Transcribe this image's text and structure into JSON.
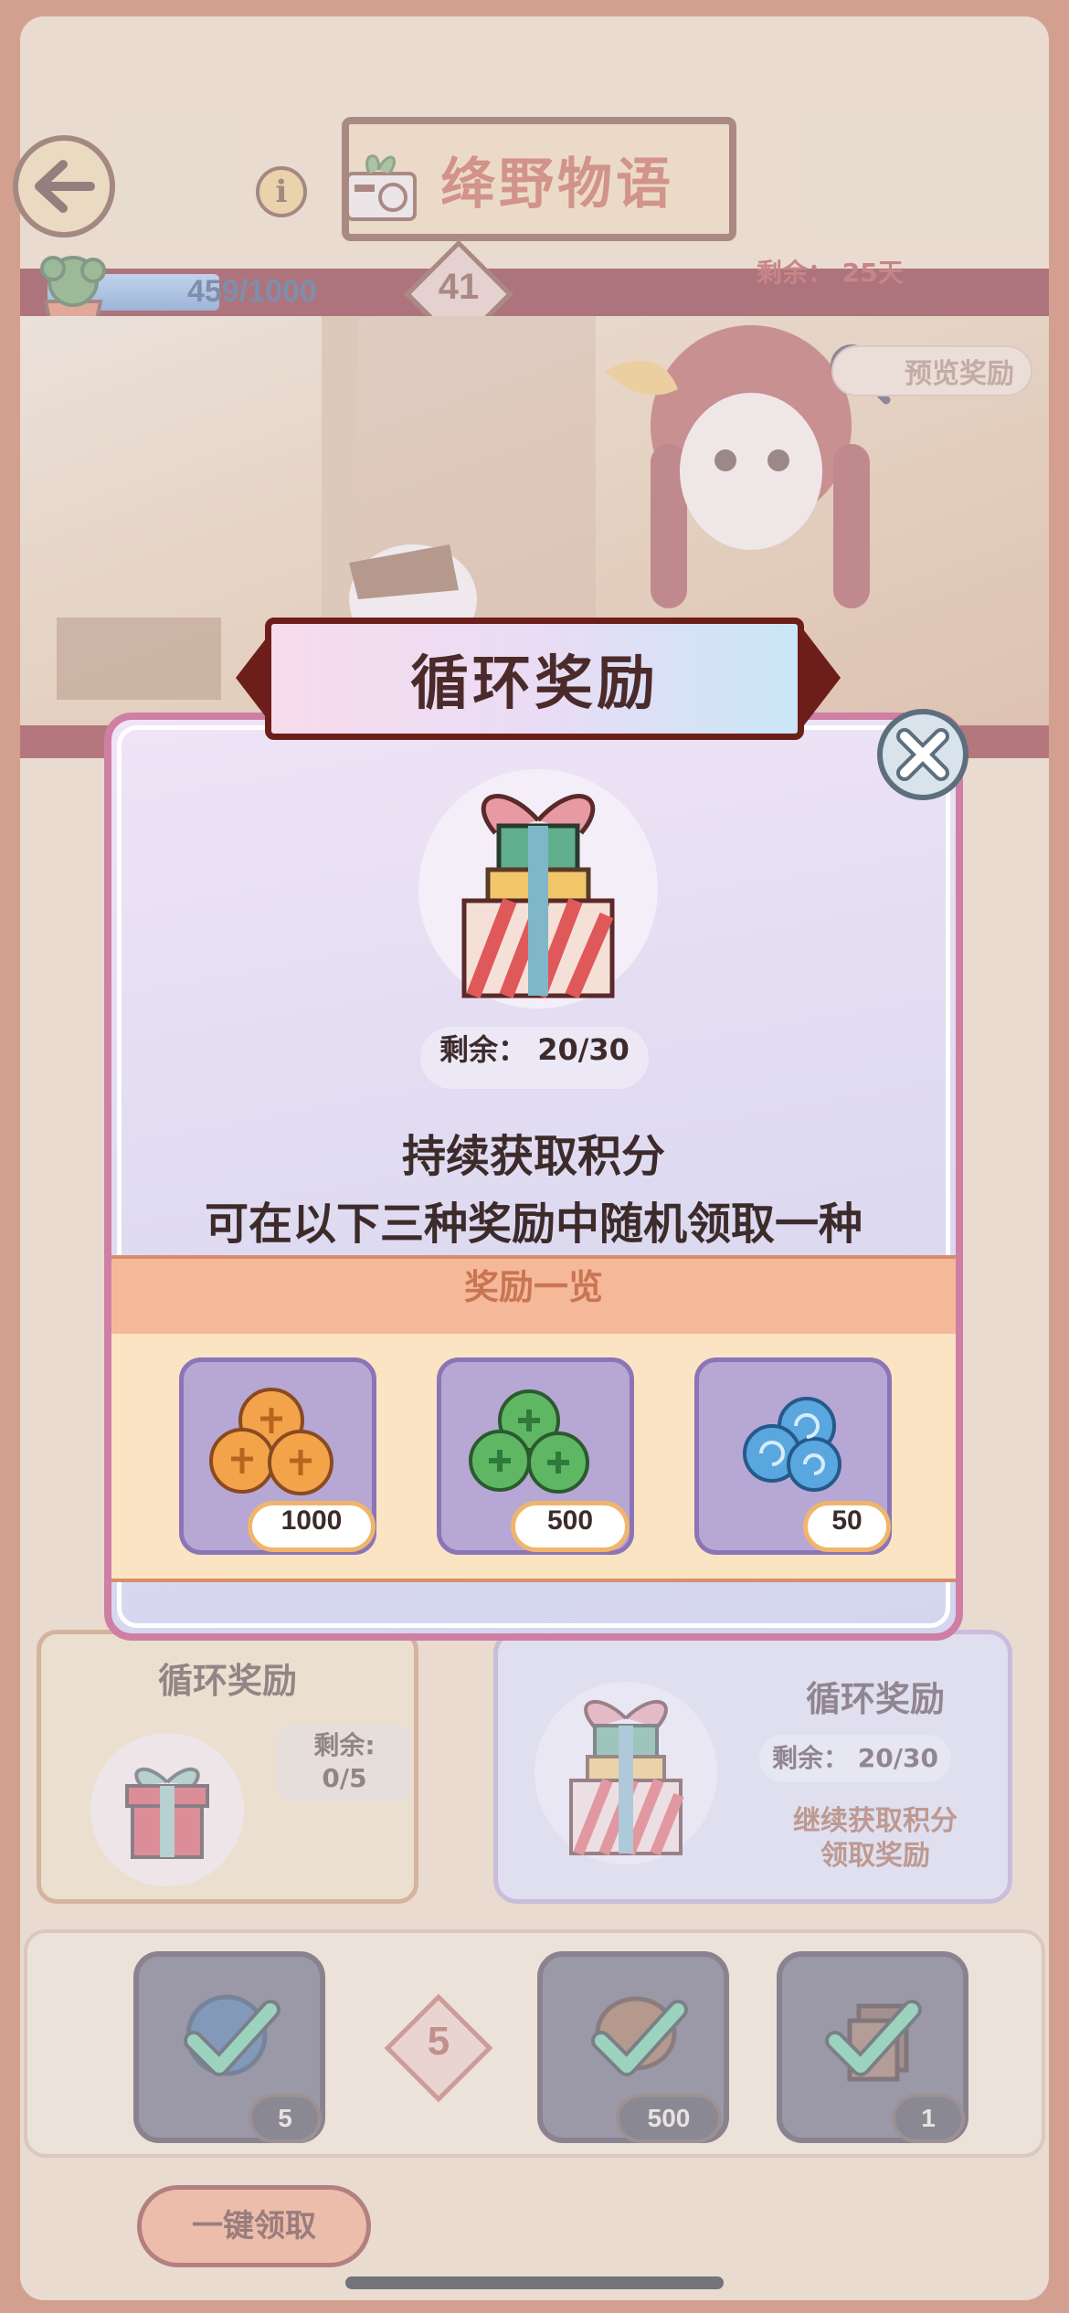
{
  "header": {
    "title": "绛野物语",
    "progress_text": "459/1000",
    "progress": {
      "current": 459,
      "max": 1000
    },
    "level": "41",
    "remaining_days": "剩余：  25天",
    "preview_label": "预览奖励"
  },
  "cards": {
    "left": {
      "title": "循环奖励",
      "remain_label": "剩余:",
      "remain_value": "0/5"
    },
    "right": {
      "title": "循环奖励",
      "remain": "剩余：  20/30",
      "hint_line1": "继续获取积分",
      "hint_line2": "领取奖励"
    }
  },
  "strip": {
    "tier": "5",
    "slots": [
      {
        "icon": "blue-orb-icon",
        "count": "5",
        "claimed": true
      },
      {
        "icon": "brown-seed-icon",
        "count": "500",
        "claimed": true
      },
      {
        "icon": "book-stack-icon",
        "count": "1",
        "claimed": true
      }
    ],
    "claim_all_label": "一键领取"
  },
  "modal": {
    "title": "循环奖励",
    "remain": "剩余：  20/30",
    "line1": "持续获取积分",
    "line2": "可在以下三种奖励中随机领取一种",
    "list_header": "奖励一览",
    "rewards": [
      {
        "icon": "orange-coin-icon",
        "amount": "1000",
        "color": "#f3a34a"
      },
      {
        "icon": "green-clover-coin-icon",
        "amount": "500",
        "color": "#5fb764"
      },
      {
        "icon": "blue-swirl-gem-icon",
        "amount": "50",
        "color": "#5aa6df"
      }
    ]
  },
  "colors": {
    "accent": "#7d1416",
    "modal_border": "#cf7fa4",
    "list_header": "#f5b99a"
  }
}
